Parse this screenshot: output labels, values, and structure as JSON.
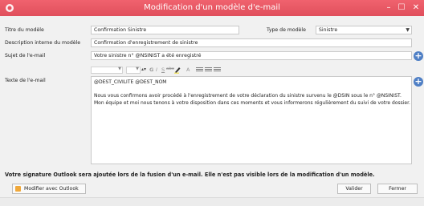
{
  "window": {
    "title": "Modification d'un modèle d'e-mail",
    "controls": {
      "minimize": "–",
      "maximize": "☐",
      "close": "✕"
    },
    "accent_color": "#e8525f"
  },
  "form": {
    "titre_label": "Titre du modèle",
    "titre_value": "Confirmation Sinistre",
    "type_label": "Type de modèle",
    "type_value": "Sinistre",
    "description_label": "Description interne du modèle",
    "description_value": "Confirmation d'enregistrement de sinistre",
    "sujet_label": "Sujet de l'e-mail",
    "sujet_value": "Votre sinistre n° @NSINIST a été enregistré",
    "texte_label": "Texte de l'e-mail"
  },
  "editor": {
    "lines": [
      "@DEST_CIVILITE @DEST_NOM",
      "Nous vous confirmons avoir procédé à l'enregistrement de votre déclaration du sinistre survenu le @DSIN sous le n° @NSINIST.",
      "Mon équipe et moi nous tenons à votre disposition dans ces moments et vous informerons régulièrement du suivi de votre dossier."
    ],
    "toolbar": {
      "bold": "G",
      "italic": "I",
      "underline": "S",
      "strike": "abc",
      "font_color": "A"
    }
  },
  "note": "Votre signature Outlook sera ajoutée lors de la fusion d'un e-mail. Elle n'est pas visible lors de la modification d'un modèle.",
  "buttons": {
    "outlook": "Modifier avec Outlook",
    "valider": "Valider",
    "fermer": "Fermer"
  },
  "icons": {
    "app": "app-icon",
    "add_subject_field": "plus-circle-icon",
    "add_body_field": "plus-circle-icon",
    "outlook": "outlook-icon"
  }
}
